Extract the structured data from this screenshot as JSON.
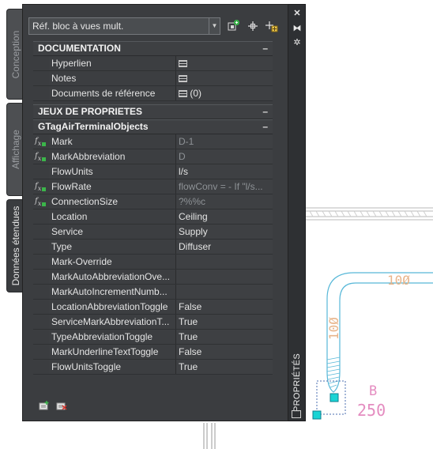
{
  "tabs": {
    "conception": "Conception",
    "affichage": "Affichage",
    "donnees": "Données étendues"
  },
  "palette_title": "PROPRIÉTÉS",
  "selector": {
    "value": "Réf. bloc à vues mult."
  },
  "sections": {
    "documentation": {
      "title": "DOCUMENTATION",
      "rows": [
        {
          "name": "Hyperlien",
          "value": ""
        },
        {
          "name": "Notes",
          "value": ""
        },
        {
          "name": "Documents de référence",
          "value": "(0)"
        }
      ]
    },
    "jeux": {
      "title": "JEUX DE PROPRIETES"
    },
    "gtag": {
      "title": "GTagAirTerminalObjects",
      "rows": [
        {
          "name": "Mark",
          "value": "D-1"
        },
        {
          "name": "MarkAbbreviation",
          "value": "D"
        },
        {
          "name": "FlowUnits",
          "value": "l/s"
        },
        {
          "name": "FlowRate",
          "value": "flowConv = - If \"l/s..."
        },
        {
          "name": "ConnectionSize",
          "value": "?%%c"
        },
        {
          "name": "Location",
          "value": "Ceiling"
        },
        {
          "name": "Service",
          "value": "Supply"
        },
        {
          "name": "Type",
          "value": "Diffuser"
        },
        {
          "name": "Mark-Override",
          "value": ""
        },
        {
          "name": "MarkAutoAbbreviationOve...",
          "value": ""
        },
        {
          "name": "MarkAutoIncrementNumb...",
          "value": ""
        },
        {
          "name": "LocationAbbreviationToggle",
          "value": "False"
        },
        {
          "name": "ServiceMarkAbbreviationT...",
          "value": "True"
        },
        {
          "name": "TypeAbbreviationToggle",
          "value": "True"
        },
        {
          "name": "MarkUnderlineTextToggle",
          "value": "False"
        },
        {
          "name": "FlowUnitsToggle",
          "value": "True"
        }
      ]
    }
  },
  "drawing": {
    "label_duct_h": "10Ø",
    "label_duct_v": "10Ø",
    "tag_letter": "B",
    "tag_number": "250"
  },
  "colors": {
    "duct": "#58b8d8",
    "dim_text": "#e8b48a",
    "tag_text": "#e48cc0",
    "grip": "#19d4d4"
  }
}
